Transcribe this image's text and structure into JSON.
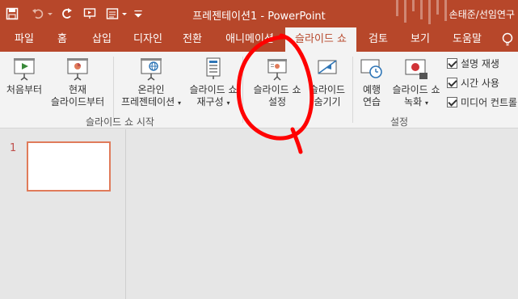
{
  "window": {
    "title": "프레젠테이션1 - PowerPoint",
    "user": "손태준/선임연구"
  },
  "qat": {
    "icons": [
      "save-icon",
      "undo-icon",
      "redo-icon",
      "present-from-start-icon",
      "layout-icon",
      "customize-qat-icon"
    ]
  },
  "tabs": [
    {
      "label": "파일"
    },
    {
      "label": "홈"
    },
    {
      "label": "삽입"
    },
    {
      "label": "디자인"
    },
    {
      "label": "전환"
    },
    {
      "label": "애니메이션"
    },
    {
      "label": "슬라이드 쇼"
    },
    {
      "label": "검토"
    },
    {
      "label": "보기"
    },
    {
      "label": "도움말"
    }
  ],
  "ribbon": {
    "start_group": {
      "label": "슬라이드 쇼 시작",
      "from_beginning": "처음부터",
      "from_current_1": "현재",
      "from_current_2": "슬라이드부터",
      "online_1": "온라인",
      "online_2": "프레젠테이션",
      "custom_1": "슬라이드 쇼",
      "custom_2": "재구성"
    },
    "setup_group": {
      "label": "설정",
      "setup_1": "슬라이드 쇼",
      "setup_2": "설정",
      "hide_1": "슬라이드",
      "hide_2": "숨기기",
      "rehearse_1": "예행",
      "rehearse_2": "연습",
      "record_1": "슬라이드 쇼",
      "record_2": "녹화",
      "checkboxes": [
        {
          "label": "설명 재생",
          "checked": true
        },
        {
          "label": "시간 사용",
          "checked": true
        },
        {
          "label": "미디어 컨트롤",
          "checked": true
        }
      ]
    }
  },
  "thumbnails": {
    "slide_number": "1"
  },
  "colors": {
    "accent": "#b7472a",
    "annotation": "#ff0000"
  }
}
